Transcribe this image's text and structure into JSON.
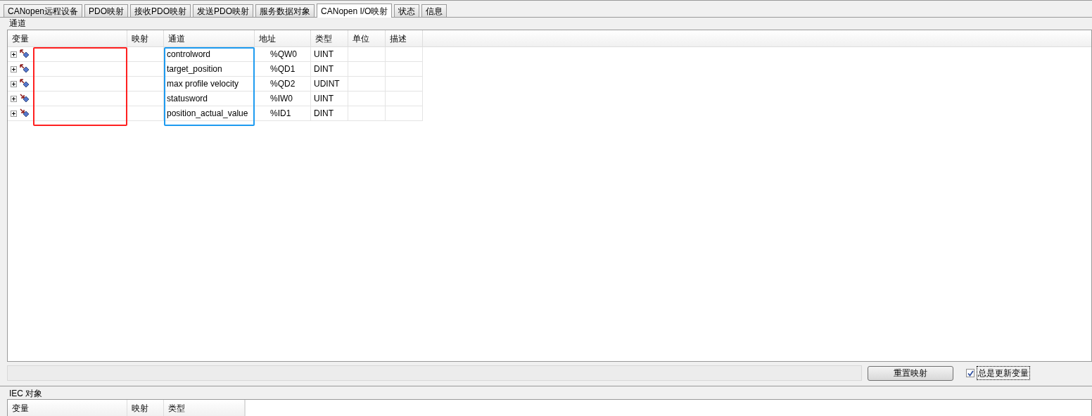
{
  "tabs": [
    {
      "label": "CANopen远程设备",
      "selected": false
    },
    {
      "label": "PDO映射",
      "selected": false
    },
    {
      "label": "接收PDO映射",
      "selected": false
    },
    {
      "label": "发送PDO映射",
      "selected": false
    },
    {
      "label": "服务数据对象",
      "selected": false
    },
    {
      "label": "CANopen I/O映射",
      "selected": true
    },
    {
      "label": "状态",
      "selected": false
    },
    {
      "label": "信息",
      "selected": false
    }
  ],
  "channels": {
    "title": "通道",
    "columns": [
      "变量",
      "映射",
      "通道",
      "地址",
      "类型",
      "单位",
      "描述"
    ],
    "rows": [
      {
        "kind": "output",
        "channel": "controlword",
        "address": "%QW0",
        "type": "UINT"
      },
      {
        "kind": "output",
        "channel": "target_position",
        "address": "%QD1",
        "type": "DINT"
      },
      {
        "kind": "output",
        "channel": "max profile velocity",
        "address": "%QD2",
        "type": "UDINT"
      },
      {
        "kind": "input",
        "channel": "statusword",
        "address": "%IW0",
        "type": "UINT"
      },
      {
        "kind": "input",
        "channel": "position_actual_value",
        "address": "%ID1",
        "type": "DINT"
      }
    ],
    "highlights": [
      {
        "color": "#ff2020"
      },
      {
        "color": "#1e9bf0"
      }
    ]
  },
  "reset_button": "重置映射",
  "always_update": {
    "label": "总是更新变量",
    "checked": true
  },
  "iec_objects": {
    "title": "IEC 对象",
    "columns": [
      "变量",
      "映射",
      "类型"
    ]
  }
}
